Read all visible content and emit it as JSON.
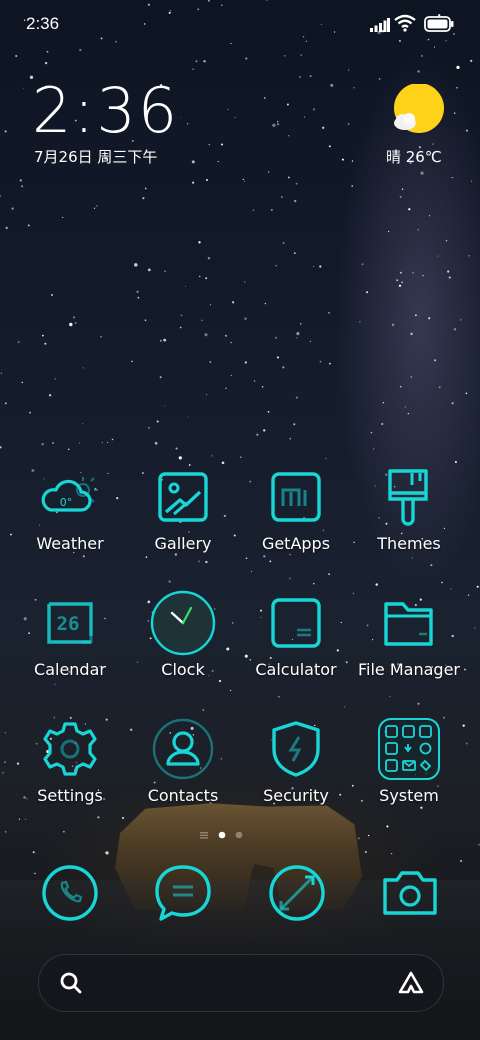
{
  "status_bar": {
    "time": "2:36"
  },
  "clock_widget": {
    "time": "2:36",
    "date": "7月26日 周三下午"
  },
  "weather_widget": {
    "condition_temp": "晴 26℃"
  },
  "apps": [
    {
      "label": "Weather",
      "icon": "weather-icon",
      "badge": "0°"
    },
    {
      "label": "Gallery",
      "icon": "gallery-icon"
    },
    {
      "label": "GetApps",
      "icon": "getapps-icon"
    },
    {
      "label": "Themes",
      "icon": "themes-icon"
    },
    {
      "label": "Calendar",
      "icon": "calendar-icon",
      "badge": "26"
    },
    {
      "label": "Clock",
      "icon": "clock-icon"
    },
    {
      "label": "Calculator",
      "icon": "calculator-icon"
    },
    {
      "label": "File Manager",
      "icon": "folder-icon"
    },
    {
      "label": "Settings",
      "icon": "gear-icon"
    },
    {
      "label": "Contacts",
      "icon": "contacts-icon"
    },
    {
      "label": "Security",
      "icon": "shield-icon"
    },
    {
      "label": "System",
      "icon": "system-folder-icon"
    }
  ],
  "page_indicator": {
    "pages": 2,
    "current": 1
  },
  "dock": [
    {
      "icon": "phone-icon"
    },
    {
      "icon": "messages-icon"
    },
    {
      "icon": "browser-icon"
    },
    {
      "icon": "camera-icon"
    }
  ],
  "search_bar": {
    "left_icon": "search-icon",
    "right_icon": "assistant-icon"
  },
  "colors": {
    "accent": "#19d6d6",
    "sun": "#ffd21a"
  }
}
